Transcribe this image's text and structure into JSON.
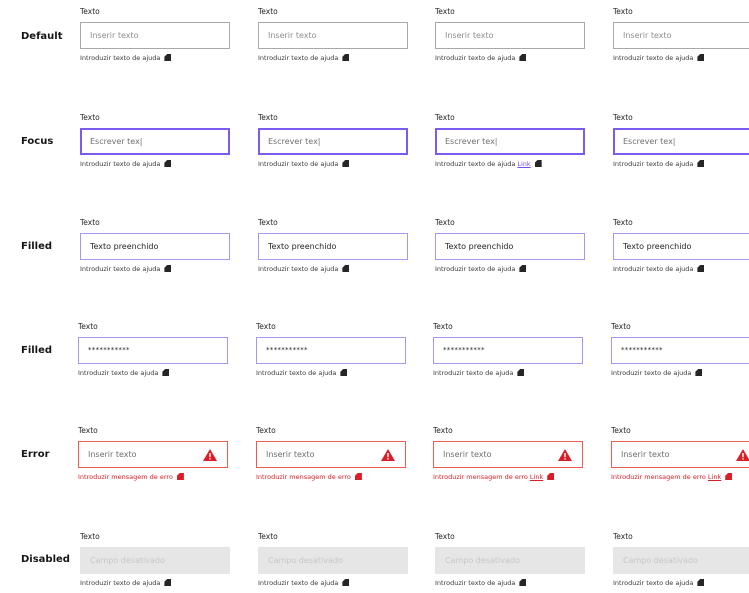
{
  "row_labels": [
    "Default",
    "Focus",
    "Filled",
    "Filled",
    "Error",
    "Disabled"
  ],
  "field_label": "Texto",
  "values": {
    "placeholder": "Inserir texto",
    "focus": "Escrever tex|",
    "filled": "Texto preenchido",
    "password": "***********",
    "disabled": "Campo desativado"
  },
  "helper": {
    "default": "Introduzir texto de ajuda",
    "error": "Introduzir mensagem de erro",
    "link": "Link"
  },
  "icons": {
    "helper_icon": "info-icon",
    "error_icon": "warning-triangle-icon",
    "error_color": "#da1e28",
    "focus_color": "#7b5cf0"
  }
}
